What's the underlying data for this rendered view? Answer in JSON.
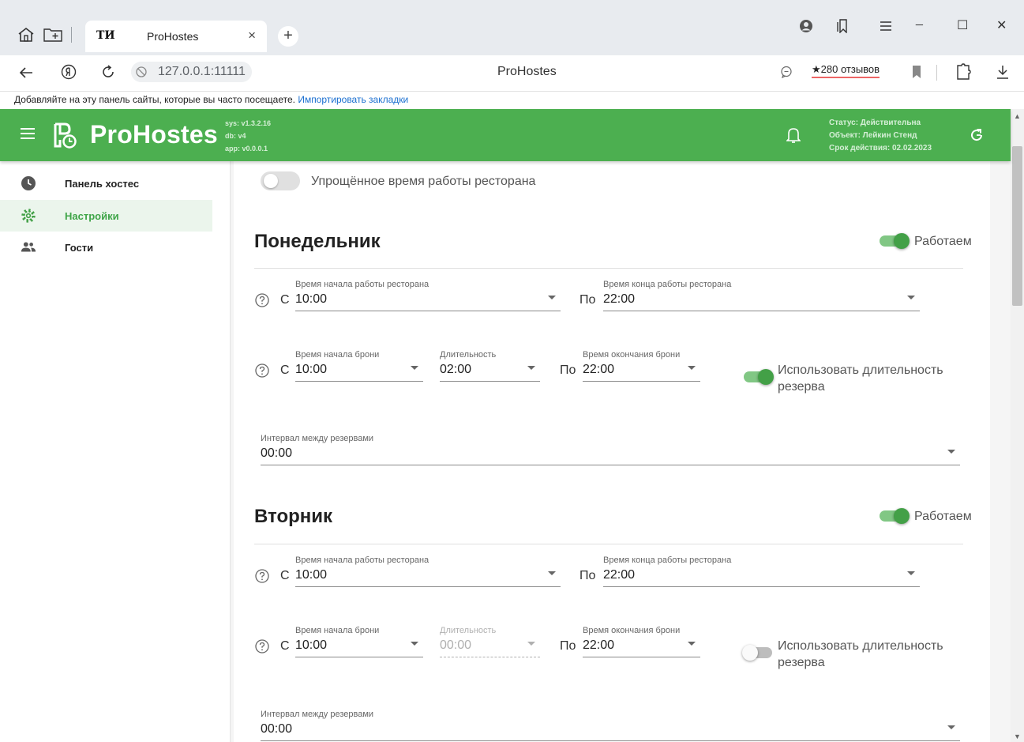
{
  "browser": {
    "tab_title": "ProHostes",
    "tab_favicon": "ТИ",
    "tab_close": "×",
    "newtab_plus": "+",
    "url": "127.0.0.1:11111",
    "page_title": "ProHostes",
    "reviews": "★280 отзывов",
    "bookmarks_text": "Добавляйте на эту панель сайты, которые вы часто посещаете.",
    "bookmarks_link": "Импортировать закладки",
    "window": {
      "minimize": "_",
      "maximize": "☐",
      "close": "✕"
    }
  },
  "header": {
    "brand": "ProHostes",
    "versions": [
      "sys: v1.3.2.16",
      "db: v4",
      "app: v0.0.0.1"
    ],
    "status": [
      "Статус: Действительна",
      "Объект: Лейкин Стенд",
      "Срок действия: 02.02.2023"
    ],
    "accent": "#4caf50"
  },
  "sidebar": {
    "items": [
      {
        "label": "Панель хостес",
        "icon": "clock-icon",
        "active": false
      },
      {
        "label": "Настройки",
        "icon": "gear-icon",
        "active": true
      },
      {
        "label": "Гости",
        "icon": "people-icon",
        "active": false
      }
    ]
  },
  "settings": {
    "simplified_label": "Упрощённое время работы ресторана",
    "simplified_on": false,
    "days": [
      {
        "title": "Понедельник",
        "working_label": "Работаем",
        "working": true,
        "prefix_from": "С",
        "prefix_to": "По",
        "open": {
          "label": "Время начала работы ресторана",
          "value": "10:00"
        },
        "close": {
          "label": "Время конца работы ресторана",
          "value": "22:00"
        },
        "booking_start": {
          "label": "Время начала брони",
          "value": "10:00"
        },
        "duration": {
          "label": "Длительность",
          "value": "02:00",
          "disabled": false
        },
        "booking_end": {
          "label": "Время окончания брони",
          "value": "22:00"
        },
        "use_duration_label": "Использовать длительность резерва",
        "use_duration": true,
        "interval": {
          "label": "Интервал между резервами",
          "value": "00:00"
        }
      },
      {
        "title": "Вторник",
        "working_label": "Работаем",
        "working": true,
        "prefix_from": "С",
        "prefix_to": "По",
        "open": {
          "label": "Время начала работы ресторана",
          "value": "10:00"
        },
        "close": {
          "label": "Время конца работы ресторана",
          "value": "22:00"
        },
        "booking_start": {
          "label": "Время начала брони",
          "value": "10:00"
        },
        "duration": {
          "label": "Длительность",
          "value": "00:00",
          "disabled": true
        },
        "booking_end": {
          "label": "Время окончания брони",
          "value": "22:00"
        },
        "use_duration_label": "Использовать длительность резерва",
        "use_duration": false,
        "interval": {
          "label": "Интервал между резервами",
          "value": "00:00"
        }
      }
    ]
  }
}
